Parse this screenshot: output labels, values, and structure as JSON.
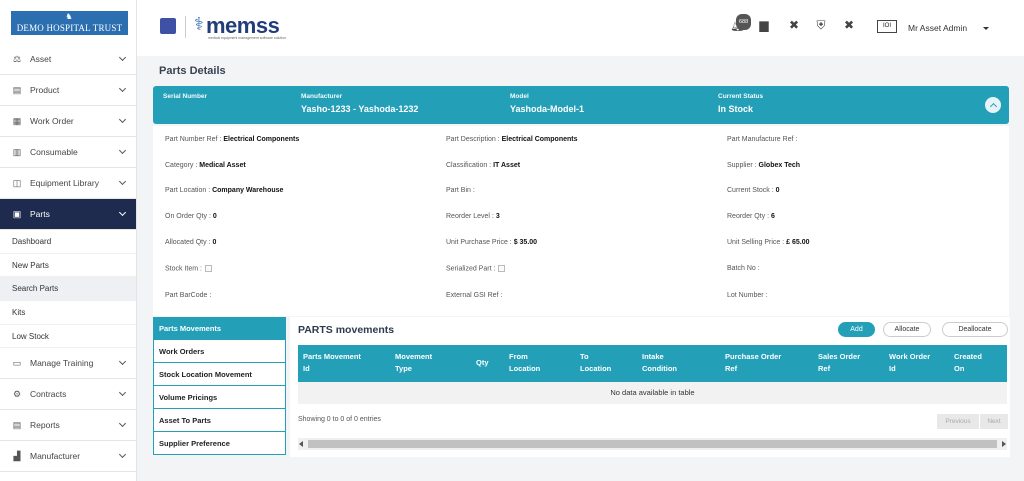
{
  "org": {
    "name": "DEMO HOSPITAL TRUST"
  },
  "brand": {
    "name": "memss",
    "tagline": "medical equipment management software solution"
  },
  "user": {
    "name": "Mr Asset Admin",
    "avatar_text": "IOI"
  },
  "notifications": {
    "count": "688"
  },
  "sidebar": {
    "items": [
      {
        "label": "Asset",
        "icon": "asset-icon",
        "glyph": "⚖"
      },
      {
        "label": "Product",
        "icon": "product-icon",
        "glyph": "▤"
      },
      {
        "label": "Work Order",
        "icon": "work-order-icon",
        "glyph": "▦"
      },
      {
        "label": "Consumable",
        "icon": "consumable-icon",
        "glyph": "▥"
      },
      {
        "label": "Equipment Library",
        "icon": "equipment-library-icon",
        "glyph": "◫"
      },
      {
        "label": "Parts",
        "icon": "parts-icon",
        "glyph": "▣"
      }
    ],
    "sub_items": [
      "Dashboard",
      "New Parts",
      "Search Parts",
      "Kits",
      "Low Stock"
    ],
    "items_after": [
      {
        "label": "Manage Training",
        "icon": "training-icon",
        "glyph": "▭"
      },
      {
        "label": "Contracts",
        "icon": "contracts-icon",
        "glyph": "⚙"
      },
      {
        "label": "Reports",
        "icon": "reports-icon",
        "glyph": "▤"
      },
      {
        "label": "Manufacturer",
        "icon": "manufacturer-icon",
        "glyph": "▟"
      }
    ]
  },
  "page": {
    "title": "Parts Details"
  },
  "banner": {
    "serial_label": "Serial Number",
    "serial_value": "",
    "manufacturer_label": "Manufacturer",
    "manufacturer_value": "Yasho-1233 - Yashoda-1232",
    "model_label": "Model",
    "model_value": "Yashoda-Model-1",
    "status_label": "Current Status",
    "status_value": "In Stock"
  },
  "details": {
    "part_number_ref": {
      "label": "Part Number Ref :",
      "value": "Electrical Components"
    },
    "part_description": {
      "label": "Part Description :",
      "value": "Electrical Components"
    },
    "part_manufacture_ref": {
      "label": "Part Manufacture Ref :",
      "value": ""
    },
    "category": {
      "label": "Category :",
      "value": "Medical Asset"
    },
    "classification": {
      "label": "Classification :",
      "value": "IT Asset"
    },
    "supplier": {
      "label": "Supplier :",
      "value": "Globex Tech"
    },
    "part_location": {
      "label": "Part Location :",
      "value": "Company Warehouse"
    },
    "part_bin": {
      "label": "Part Bin :",
      "value": ""
    },
    "current_stock": {
      "label": "Current Stock :",
      "value": "0"
    },
    "on_order_qty": {
      "label": "On Order Qty :",
      "value": "0"
    },
    "reorder_level": {
      "label": "Reorder Level :",
      "value": "3"
    },
    "reorder_qty": {
      "label": "Reorder Qty :",
      "value": "6"
    },
    "allocated_qty": {
      "label": "Allocated Qty :",
      "value": "0"
    },
    "unit_purchase_price": {
      "label": "Unit Purchase Price :",
      "value": "$ 35.00"
    },
    "unit_selling_price": {
      "label": "Unit Selling Price :",
      "value": "£ 65.00"
    },
    "stock_item": {
      "label": "Stock Item :"
    },
    "serialized_part": {
      "label": "Serialized Part :"
    },
    "batch_no": {
      "label": "Batch No :",
      "value": ""
    },
    "part_barcode": {
      "label": "Part BarCode :",
      "value": ""
    },
    "external_gsi_ref": {
      "label": "External GSI Ref :",
      "value": ""
    },
    "lot_number": {
      "label": "Lot Number :",
      "value": ""
    }
  },
  "tabs": [
    "Parts Movements",
    "Work Orders",
    "Stock Location Movement",
    "Volume Pricings",
    "Asset To Parts",
    "Supplier Preference"
  ],
  "movements": {
    "title": "PARTS movements",
    "add_label": "Add",
    "allocate_label": "Allocate",
    "deallocate_label": "Deallocate",
    "columns": [
      [
        "Parts Movement",
        "Id"
      ],
      [
        "Movement",
        "Type"
      ],
      [
        "Qty",
        ""
      ],
      [
        "From",
        "Location"
      ],
      [
        "To",
        "Location"
      ],
      [
        "Intake",
        "Condition"
      ],
      [
        "Purchase Order",
        "Ref"
      ],
      [
        "Sales Order",
        "Ref"
      ],
      [
        "Work Order",
        "Id"
      ],
      [
        "Created",
        "On"
      ]
    ],
    "empty_text": "No data available in table",
    "showing": "Showing 0 to 0 of 0 entries",
    "prev_label": "Previous",
    "next_label": "Next"
  }
}
